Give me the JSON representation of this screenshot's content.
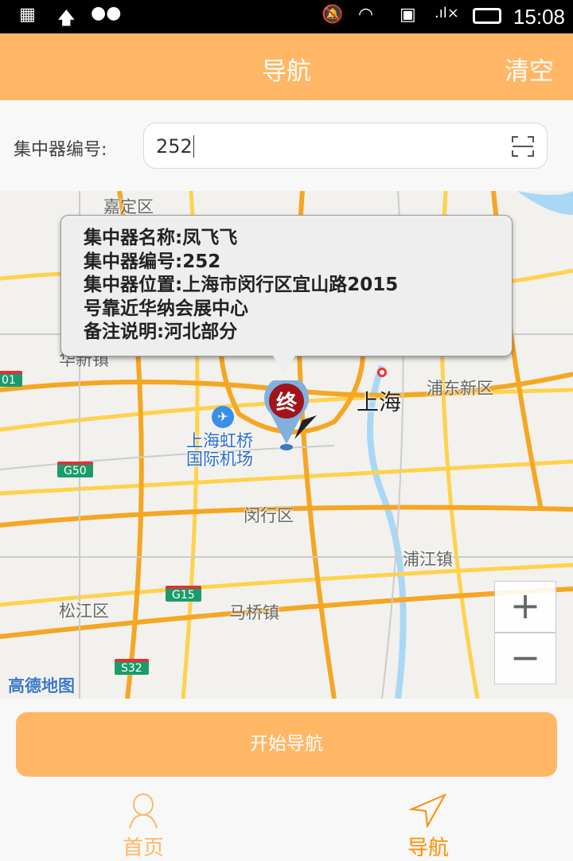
{
  "status_bar": {
    "time": "15:08",
    "icons": [
      "apps-icon",
      "upload-icon",
      "android-icon",
      "mute-icon",
      "wifi-icon",
      "sim-off-icon",
      "signal-icon",
      "battery-icon"
    ]
  },
  "header": {
    "title": "导航",
    "clear_label": "清空"
  },
  "form": {
    "label": "集中器编号:",
    "value": "252"
  },
  "map": {
    "labels": {
      "jiading": "嘉定区",
      "huaxin": "华新镇",
      "shanghai": "上海",
      "pudong": "浦东新区",
      "airport1": "上海虹桥",
      "airport2": "国际机场",
      "minhang": "闵行区",
      "pujiang": "浦江镇",
      "songjiang": "松江区",
      "maqiao": "马桥镇",
      "g50": "G50",
      "g15": "G15",
      "s32": "S32",
      "edge": "01",
      "logo": "高德地图"
    },
    "marker_label": "终",
    "popup": [
      "集中器名称:凤飞飞",
      "集中器编号:252",
      "集中器位置:上海市闵行区宜山路2015",
      "号靠近华纳会展中心",
      "备注说明:河北部分"
    ],
    "zoom_in": "+",
    "zoom_out": "−"
  },
  "start_button": "开始导航",
  "tabs": [
    {
      "label": "首页",
      "color": "#ffb766"
    },
    {
      "label": "导航",
      "color": "#ff8c00"
    }
  ],
  "colors": {
    "accent": "#ffb766",
    "active": "#ff8c00"
  }
}
